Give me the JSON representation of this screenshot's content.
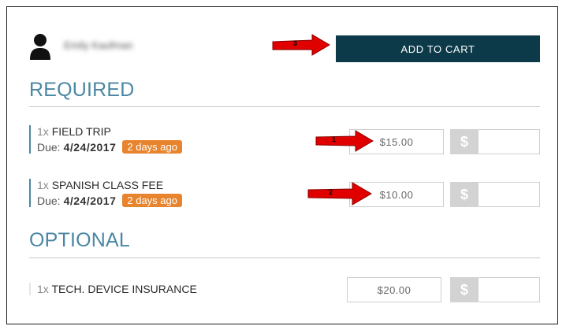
{
  "user": {
    "name": "Emily Kaufman"
  },
  "cart": {
    "add_label": "ADD TO CART"
  },
  "required": {
    "title": "REQUIRED",
    "items": [
      {
        "qty": "1x",
        "name": "FIELD TRIP",
        "due_label": "Due:",
        "due_date": "4/24/2017",
        "badge": "2 days ago",
        "price": "$15.00",
        "dollar": "$"
      },
      {
        "qty": "1x",
        "name": "SPANISH CLASS FEE",
        "due_label": "Due:",
        "due_date": "4/24/2017",
        "badge": "2 days ago",
        "price": "$10.00",
        "dollar": "$"
      }
    ]
  },
  "optional": {
    "title": "OPTIONAL",
    "items": [
      {
        "qty": "1x",
        "name": "TECH. DEVICE INSURANCE",
        "price": "$20.00",
        "dollar": "$"
      }
    ]
  },
  "callouts": {
    "one": "1",
    "two": "2",
    "three": "3"
  },
  "colors": {
    "accent": "#4a87a3",
    "button": "#0d3a48",
    "badge": "#e8842e",
    "arrow": "#e00000"
  }
}
